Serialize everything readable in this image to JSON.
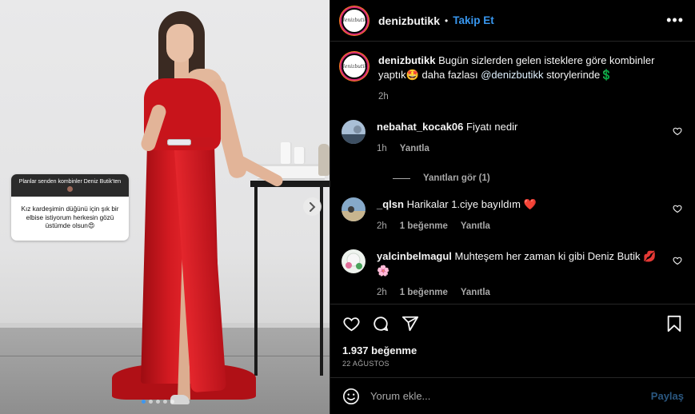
{
  "media": {
    "story_question_header": "Planlar senden kombinler Deniz Butik'ten",
    "story_question_answer": "Kız kardeşimin düğünü için şık bir elbise istiyorum herkesin gözü üstümde olsun😍",
    "carousel_dot_count": 5,
    "carousel_active_index": 0,
    "next_icon": "chevron-right-icon"
  },
  "header": {
    "avatar_logo": "denizbutik",
    "username": "denizbutikk",
    "separator": "•",
    "follow_label": "Takip Et",
    "more_label": "•••"
  },
  "caption": {
    "username": "denizbutikk",
    "text_before": " Bugün sizlerden gelen isteklere göre kombinler yaptık🤩 daha fazlası ",
    "mention": "@denizbutikk",
    "text_after": " storylerinde💲",
    "time": "2h"
  },
  "comments": [
    {
      "username": "nebahat_kocak06",
      "text": " Fiyatı nedir",
      "time": "1h",
      "likes": "",
      "reply": "Yanıtla"
    },
    {
      "username": "_qlsn",
      "text": " Harikalar 1.ciye bayıldım ❤️",
      "time": "2h",
      "likes": "1 beğenme",
      "reply": "Yanıtla"
    },
    {
      "username": "yalcinbelmagul",
      "text": " Muhteşem her zaman ki gibi Deniz Butik 💋 🌸",
      "time": "2h",
      "likes": "1 beğenme",
      "reply": "Yanıtla"
    }
  ],
  "view_replies": "Yanıtları gör (1)",
  "actions": {
    "like_icon": "heart-icon",
    "comment_icon": "comment-icon",
    "share_icon": "share-icon",
    "save_icon": "bookmark-icon"
  },
  "likes_text": "1.937 beğenme",
  "date_text": "22 AĞUSTOS",
  "comment_input": {
    "placeholder": "Yorum ekle...",
    "post_label": "Paylaş"
  },
  "colors": {
    "accent": "#3897f0",
    "background": "#000000",
    "secondary_text": "#a8a8a8",
    "heart_red": "#ed4956"
  }
}
